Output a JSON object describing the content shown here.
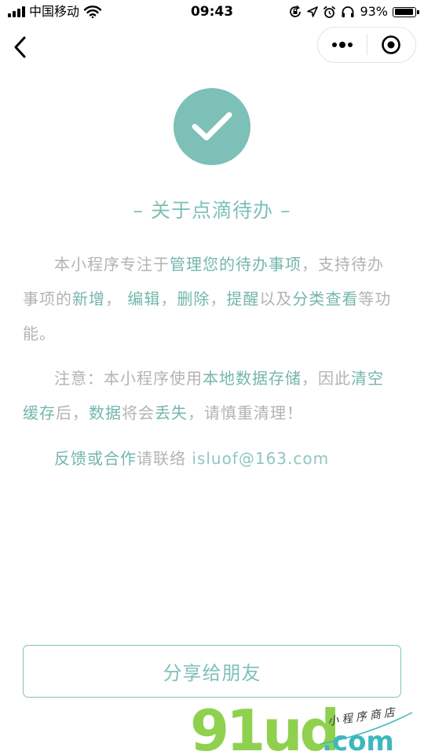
{
  "status_bar": {
    "carrier": "中国移动",
    "time": "09:43",
    "battery_percent": "93%",
    "battery_level": 0.93,
    "icons": [
      "signal-icon",
      "wifi-icon",
      "orientation-lock-icon",
      "location-icon",
      "alarm-icon",
      "headphones-icon",
      "battery-icon"
    ]
  },
  "nav": {
    "back_icon": "chevron-left-icon",
    "capsule_icons": [
      "more-dots-icon",
      "close-target-icon"
    ]
  },
  "page": {
    "title": "– 关于点滴待办 –",
    "paragraphs": {
      "p1": [
        {
          "text": "本小程序专注于",
          "highlight": false
        },
        {
          "text": "管理您的待办事项",
          "highlight": true
        },
        {
          "text": "，支持待办事项的",
          "highlight": false
        },
        {
          "text": "新增",
          "highlight": true
        },
        {
          "text": "， ",
          "highlight": false
        },
        {
          "text": "编辑",
          "highlight": true
        },
        {
          "text": "，",
          "highlight": false
        },
        {
          "text": "删除",
          "highlight": true
        },
        {
          "text": "，",
          "highlight": false
        },
        {
          "text": "提醒",
          "highlight": true
        },
        {
          "text": "以及",
          "highlight": false
        },
        {
          "text": "分类查看",
          "highlight": true
        },
        {
          "text": "等功能。",
          "highlight": false
        }
      ],
      "p2": [
        {
          "text": "注意：本小程序使用",
          "highlight": false
        },
        {
          "text": "本地数据存储",
          "highlight": true
        },
        {
          "text": "，因此",
          "highlight": false
        },
        {
          "text": "清空缓存",
          "highlight": true
        },
        {
          "text": "后，",
          "highlight": false
        },
        {
          "text": "数据",
          "highlight": true
        },
        {
          "text": "将会",
          "highlight": false
        },
        {
          "text": "丢失",
          "highlight": true
        },
        {
          "text": "，请慎重清理！",
          "highlight": false
        }
      ],
      "p3": {
        "lead": "反馈或合作",
        "middle": "请联络 ",
        "email": "isluof@163.com"
      }
    },
    "share_button": "分享给朋友"
  },
  "watermark": {
    "brand": "91ud",
    "tagline": "小程序商店",
    "domain": ".com"
  },
  "colors": {
    "accent": "#7cc0b8",
    "highlight_text": "#74b6ad",
    "body_text": "#b3b3b3",
    "watermark_green": "#8fd14f",
    "watermark_teal": "#3cb8bd"
  }
}
